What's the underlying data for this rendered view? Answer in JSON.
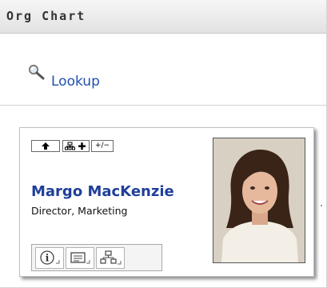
{
  "window": {
    "title": "Org Chart"
  },
  "lookup": {
    "label": "Lookup",
    "icon": "magnifier-icon"
  },
  "card": {
    "name": "Margo MacKenzie",
    "role": "Director, Marketing",
    "toolbar": [
      {
        "icon": "up-arrow-icon"
      },
      {
        "icon": "org-add-icon"
      },
      {
        "icon": "expand-collapse-icon",
        "label": "+/−"
      }
    ],
    "actions": [
      {
        "icon": "info-icon"
      },
      {
        "icon": "vcard-icon"
      },
      {
        "icon": "org-structure-icon"
      }
    ],
    "photo": {
      "icon": "person-photo"
    }
  },
  "colors": {
    "link": "#2050b0",
    "name": "#1f3f9a",
    "titlebar": "#e2e2e2"
  }
}
